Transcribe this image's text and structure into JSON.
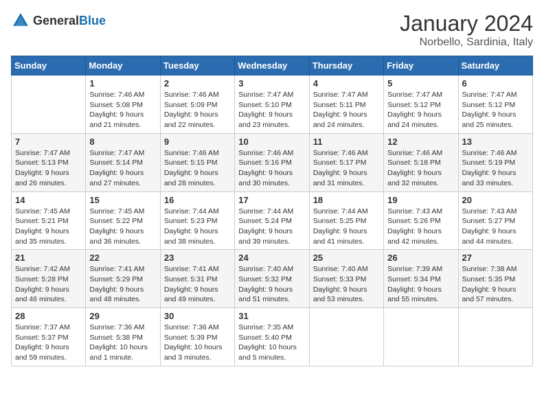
{
  "header": {
    "logo_general": "General",
    "logo_blue": "Blue",
    "month": "January 2024",
    "location": "Norbello, Sardinia, Italy"
  },
  "weekdays": [
    "Sunday",
    "Monday",
    "Tuesday",
    "Wednesday",
    "Thursday",
    "Friday",
    "Saturday"
  ],
  "weeks": [
    [
      {
        "day": "",
        "sunrise": "",
        "sunset": "",
        "daylight": ""
      },
      {
        "day": "1",
        "sunrise": "Sunrise: 7:46 AM",
        "sunset": "Sunset: 5:08 PM",
        "daylight": "Daylight: 9 hours and 21 minutes."
      },
      {
        "day": "2",
        "sunrise": "Sunrise: 7:46 AM",
        "sunset": "Sunset: 5:09 PM",
        "daylight": "Daylight: 9 hours and 22 minutes."
      },
      {
        "day": "3",
        "sunrise": "Sunrise: 7:47 AM",
        "sunset": "Sunset: 5:10 PM",
        "daylight": "Daylight: 9 hours and 23 minutes."
      },
      {
        "day": "4",
        "sunrise": "Sunrise: 7:47 AM",
        "sunset": "Sunset: 5:11 PM",
        "daylight": "Daylight: 9 hours and 24 minutes."
      },
      {
        "day": "5",
        "sunrise": "Sunrise: 7:47 AM",
        "sunset": "Sunset: 5:12 PM",
        "daylight": "Daylight: 9 hours and 24 minutes."
      },
      {
        "day": "6",
        "sunrise": "Sunrise: 7:47 AM",
        "sunset": "Sunset: 5:12 PM",
        "daylight": "Daylight: 9 hours and 25 minutes."
      }
    ],
    [
      {
        "day": "7",
        "sunrise": "Sunrise: 7:47 AM",
        "sunset": "Sunset: 5:13 PM",
        "daylight": "Daylight: 9 hours and 26 minutes."
      },
      {
        "day": "8",
        "sunrise": "Sunrise: 7:47 AM",
        "sunset": "Sunset: 5:14 PM",
        "daylight": "Daylight: 9 hours and 27 minutes."
      },
      {
        "day": "9",
        "sunrise": "Sunrise: 7:46 AM",
        "sunset": "Sunset: 5:15 PM",
        "daylight": "Daylight: 9 hours and 28 minutes."
      },
      {
        "day": "10",
        "sunrise": "Sunrise: 7:46 AM",
        "sunset": "Sunset: 5:16 PM",
        "daylight": "Daylight: 9 hours and 30 minutes."
      },
      {
        "day": "11",
        "sunrise": "Sunrise: 7:46 AM",
        "sunset": "Sunset: 5:17 PM",
        "daylight": "Daylight: 9 hours and 31 minutes."
      },
      {
        "day": "12",
        "sunrise": "Sunrise: 7:46 AM",
        "sunset": "Sunset: 5:18 PM",
        "daylight": "Daylight: 9 hours and 32 minutes."
      },
      {
        "day": "13",
        "sunrise": "Sunrise: 7:46 AM",
        "sunset": "Sunset: 5:19 PM",
        "daylight": "Daylight: 9 hours and 33 minutes."
      }
    ],
    [
      {
        "day": "14",
        "sunrise": "Sunrise: 7:45 AM",
        "sunset": "Sunset: 5:21 PM",
        "daylight": "Daylight: 9 hours and 35 minutes."
      },
      {
        "day": "15",
        "sunrise": "Sunrise: 7:45 AM",
        "sunset": "Sunset: 5:22 PM",
        "daylight": "Daylight: 9 hours and 36 minutes."
      },
      {
        "day": "16",
        "sunrise": "Sunrise: 7:44 AM",
        "sunset": "Sunset: 5:23 PM",
        "daylight": "Daylight: 9 hours and 38 minutes."
      },
      {
        "day": "17",
        "sunrise": "Sunrise: 7:44 AM",
        "sunset": "Sunset: 5:24 PM",
        "daylight": "Daylight: 9 hours and 39 minutes."
      },
      {
        "day": "18",
        "sunrise": "Sunrise: 7:44 AM",
        "sunset": "Sunset: 5:25 PM",
        "daylight": "Daylight: 9 hours and 41 minutes."
      },
      {
        "day": "19",
        "sunrise": "Sunrise: 7:43 AM",
        "sunset": "Sunset: 5:26 PM",
        "daylight": "Daylight: 9 hours and 42 minutes."
      },
      {
        "day": "20",
        "sunrise": "Sunrise: 7:43 AM",
        "sunset": "Sunset: 5:27 PM",
        "daylight": "Daylight: 9 hours and 44 minutes."
      }
    ],
    [
      {
        "day": "21",
        "sunrise": "Sunrise: 7:42 AM",
        "sunset": "Sunset: 5:28 PM",
        "daylight": "Daylight: 9 hours and 46 minutes."
      },
      {
        "day": "22",
        "sunrise": "Sunrise: 7:41 AM",
        "sunset": "Sunset: 5:29 PM",
        "daylight": "Daylight: 9 hours and 48 minutes."
      },
      {
        "day": "23",
        "sunrise": "Sunrise: 7:41 AM",
        "sunset": "Sunset: 5:31 PM",
        "daylight": "Daylight: 9 hours and 49 minutes."
      },
      {
        "day": "24",
        "sunrise": "Sunrise: 7:40 AM",
        "sunset": "Sunset: 5:32 PM",
        "daylight": "Daylight: 9 hours and 51 minutes."
      },
      {
        "day": "25",
        "sunrise": "Sunrise: 7:40 AM",
        "sunset": "Sunset: 5:33 PM",
        "daylight": "Daylight: 9 hours and 53 minutes."
      },
      {
        "day": "26",
        "sunrise": "Sunrise: 7:39 AM",
        "sunset": "Sunset: 5:34 PM",
        "daylight": "Daylight: 9 hours and 55 minutes."
      },
      {
        "day": "27",
        "sunrise": "Sunrise: 7:38 AM",
        "sunset": "Sunset: 5:35 PM",
        "daylight": "Daylight: 9 hours and 57 minutes."
      }
    ],
    [
      {
        "day": "28",
        "sunrise": "Sunrise: 7:37 AM",
        "sunset": "Sunset: 5:37 PM",
        "daylight": "Daylight: 9 hours and 59 minutes."
      },
      {
        "day": "29",
        "sunrise": "Sunrise: 7:36 AM",
        "sunset": "Sunset: 5:38 PM",
        "daylight": "Daylight: 10 hours and 1 minute."
      },
      {
        "day": "30",
        "sunrise": "Sunrise: 7:36 AM",
        "sunset": "Sunset: 5:39 PM",
        "daylight": "Daylight: 10 hours and 3 minutes."
      },
      {
        "day": "31",
        "sunrise": "Sunrise: 7:35 AM",
        "sunset": "Sunset: 5:40 PM",
        "daylight": "Daylight: 10 hours and 5 minutes."
      },
      {
        "day": "",
        "sunrise": "",
        "sunset": "",
        "daylight": ""
      },
      {
        "day": "",
        "sunrise": "",
        "sunset": "",
        "daylight": ""
      },
      {
        "day": "",
        "sunrise": "",
        "sunset": "",
        "daylight": ""
      }
    ]
  ]
}
